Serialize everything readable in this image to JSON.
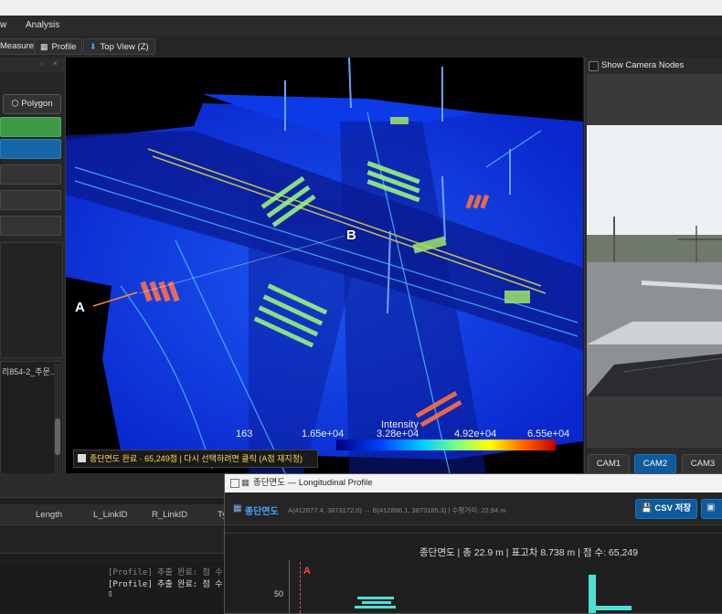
{
  "menu": {
    "item_w": "w",
    "item_analysis": "Analysis"
  },
  "toolbar": {
    "measure": "Measure",
    "profile": "Profile",
    "top_view": "Top View (Z)"
  },
  "left_panel": {
    "polygon_button": "Polygon",
    "list_item": "리854-2_주문..."
  },
  "viewport": {
    "label_a": "A",
    "label_b": "B",
    "colorbar_title": "Intensity",
    "colorbar_ticks": [
      "163",
      "1.65e+04",
      "3.28e+04",
      "4.92e+04",
      "6.55e+04"
    ],
    "status_message": "종단면도 완료 · 65,249점 | 다시 선택하려면 클릭 (A점 재지정)"
  },
  "right_panel": {
    "show_camera_nodes": "Show Camera Nodes",
    "cameras": [
      "CAM1",
      "CAM2",
      "CAM3"
    ],
    "active_camera": "CAM2"
  },
  "bottom": {
    "columns": [
      "Length",
      "L_LinkID",
      "R_LinkID",
      "Ty"
    ],
    "console": [
      "[Profile] 추출 완료: 점 수",
      "[Profile] 추출 완료: 점 수"
    ]
  },
  "profile_window": {
    "window_title": "종단면도 — Longitudinal Profile",
    "header_title": "종단면도",
    "coords": "A(412877.4, 3873172.0) → B(412896.1, 3873185.3) | 수평거리: 22.94 m",
    "csv_button": "CSV 저장",
    "plot_title": "종단면도 | 총 22.9 m | 표고차 8.738 m | 점 수: 65,249",
    "y_tick": "50",
    "marker_a": "A"
  },
  "colors": {
    "accent": "#0e5a9a",
    "green_button": "#3f9a48",
    "blue_button": "#1766a6"
  }
}
